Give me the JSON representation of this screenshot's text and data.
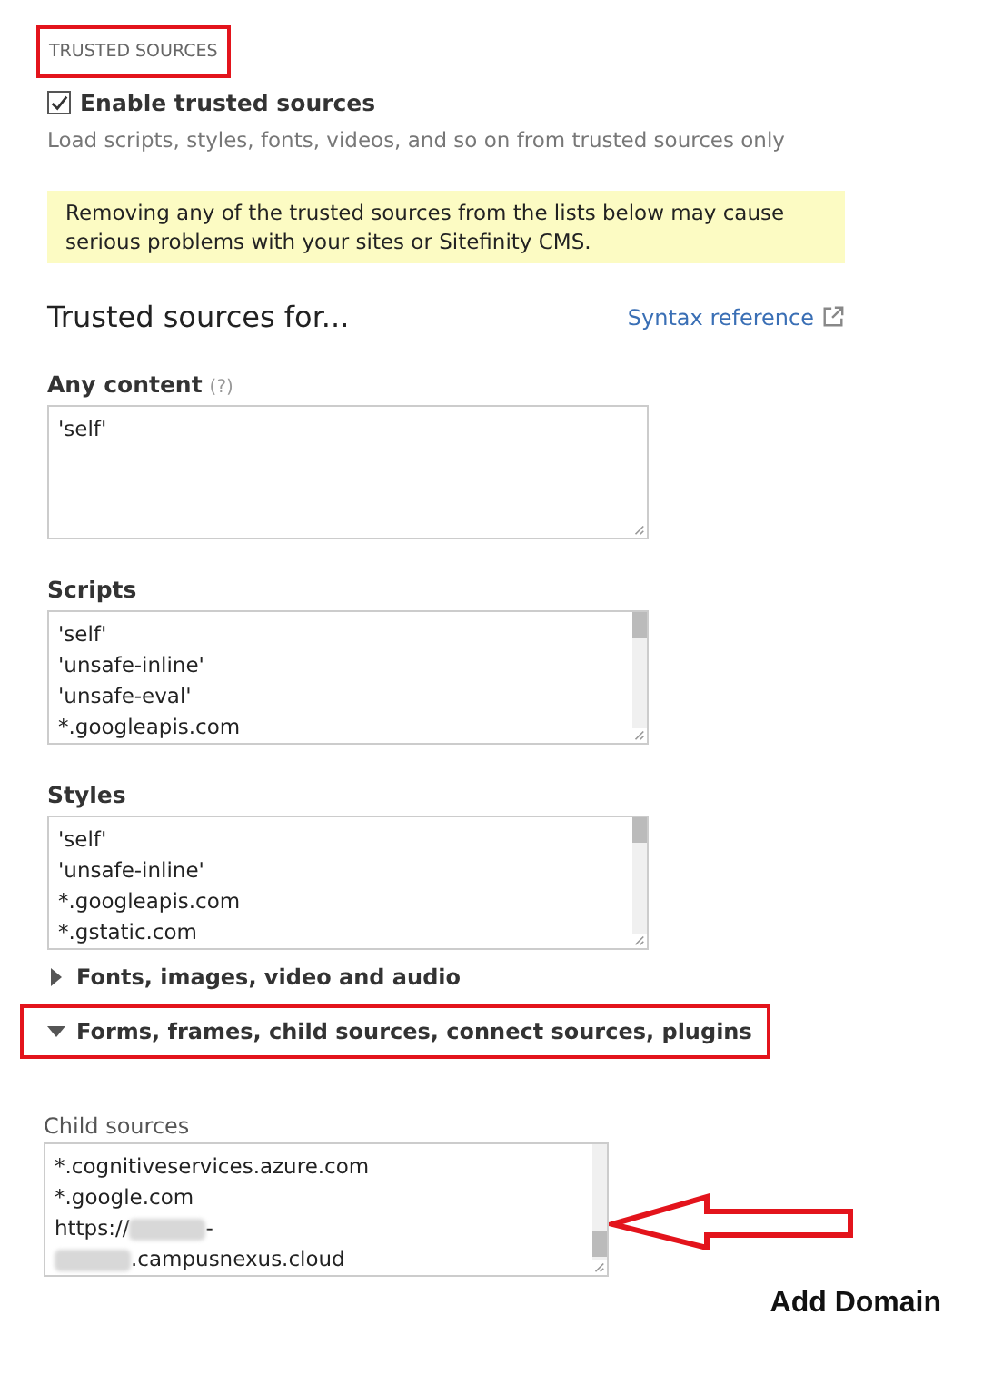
{
  "section_heading": {
    "text": "TRUSTED SOURCES",
    "highlighted": true
  },
  "enable": {
    "label": "Enable trusted sources",
    "checked": true,
    "description": "Load scripts, styles, fonts, videos, and so on from trusted sources only"
  },
  "warning": "Removing any of the trusted sources from the lists below may cause serious problems with your sites or Sitefinity CMS.",
  "sources_title": "Trusted sources for...",
  "syntax_link": "Syntax reference",
  "fields": [
    {
      "label": "Any content",
      "help": "(?)",
      "scrollbar": false,
      "lines": [
        {
          "segments": [
            {
              "kind": "text",
              "text": "'self'"
            }
          ]
        }
      ]
    },
    {
      "label": "Scripts",
      "scrollbar": true,
      "lines": [
        {
          "segments": [
            {
              "kind": "text",
              "text": "'self'"
            }
          ]
        },
        {
          "segments": [
            {
              "kind": "text",
              "text": "'unsafe-inline'"
            }
          ]
        },
        {
          "segments": [
            {
              "kind": "text",
              "text": "'unsafe-eval'"
            }
          ]
        },
        {
          "segments": [
            {
              "kind": "text",
              "text": "*.googleapis.com"
            }
          ]
        }
      ]
    },
    {
      "label": "Styles",
      "scrollbar": true,
      "lines": [
        {
          "segments": [
            {
              "kind": "text",
              "text": "'self'"
            }
          ]
        },
        {
          "segments": [
            {
              "kind": "text",
              "text": "'unsafe-inline'"
            }
          ]
        },
        {
          "segments": [
            {
              "kind": "text",
              "text": "*.googleapis.com"
            }
          ]
        },
        {
          "segments": [
            {
              "kind": "text",
              "text": "*.gstatic.com"
            }
          ]
        }
      ]
    }
  ],
  "expanders": [
    {
      "label": "Fonts, images, video and audio",
      "expanded": false,
      "highlighted": false
    },
    {
      "label": "Forms, frames, child sources, connect sources, plugins",
      "expanded": true,
      "highlighted": true
    }
  ],
  "child_sources": {
    "label": "Child sources",
    "lines": [
      {
        "segments": [
          {
            "kind": "text",
            "text": "*.cognitiveservices.azure.com"
          }
        ]
      },
      {
        "segments": [
          {
            "kind": "text",
            "text": "*.google.com"
          }
        ]
      },
      {
        "segments": [
          {
            "kind": "text",
            "text": "https://"
          },
          {
            "kind": "redacted"
          },
          {
            "kind": "text",
            "text": "-"
          }
        ]
      },
      {
        "segments": [
          {
            "kind": "redacted"
          },
          {
            "kind": "text",
            "text": ".campusnexus.cloud"
          }
        ]
      }
    ]
  },
  "annotation": {
    "text": "Add Domain"
  }
}
